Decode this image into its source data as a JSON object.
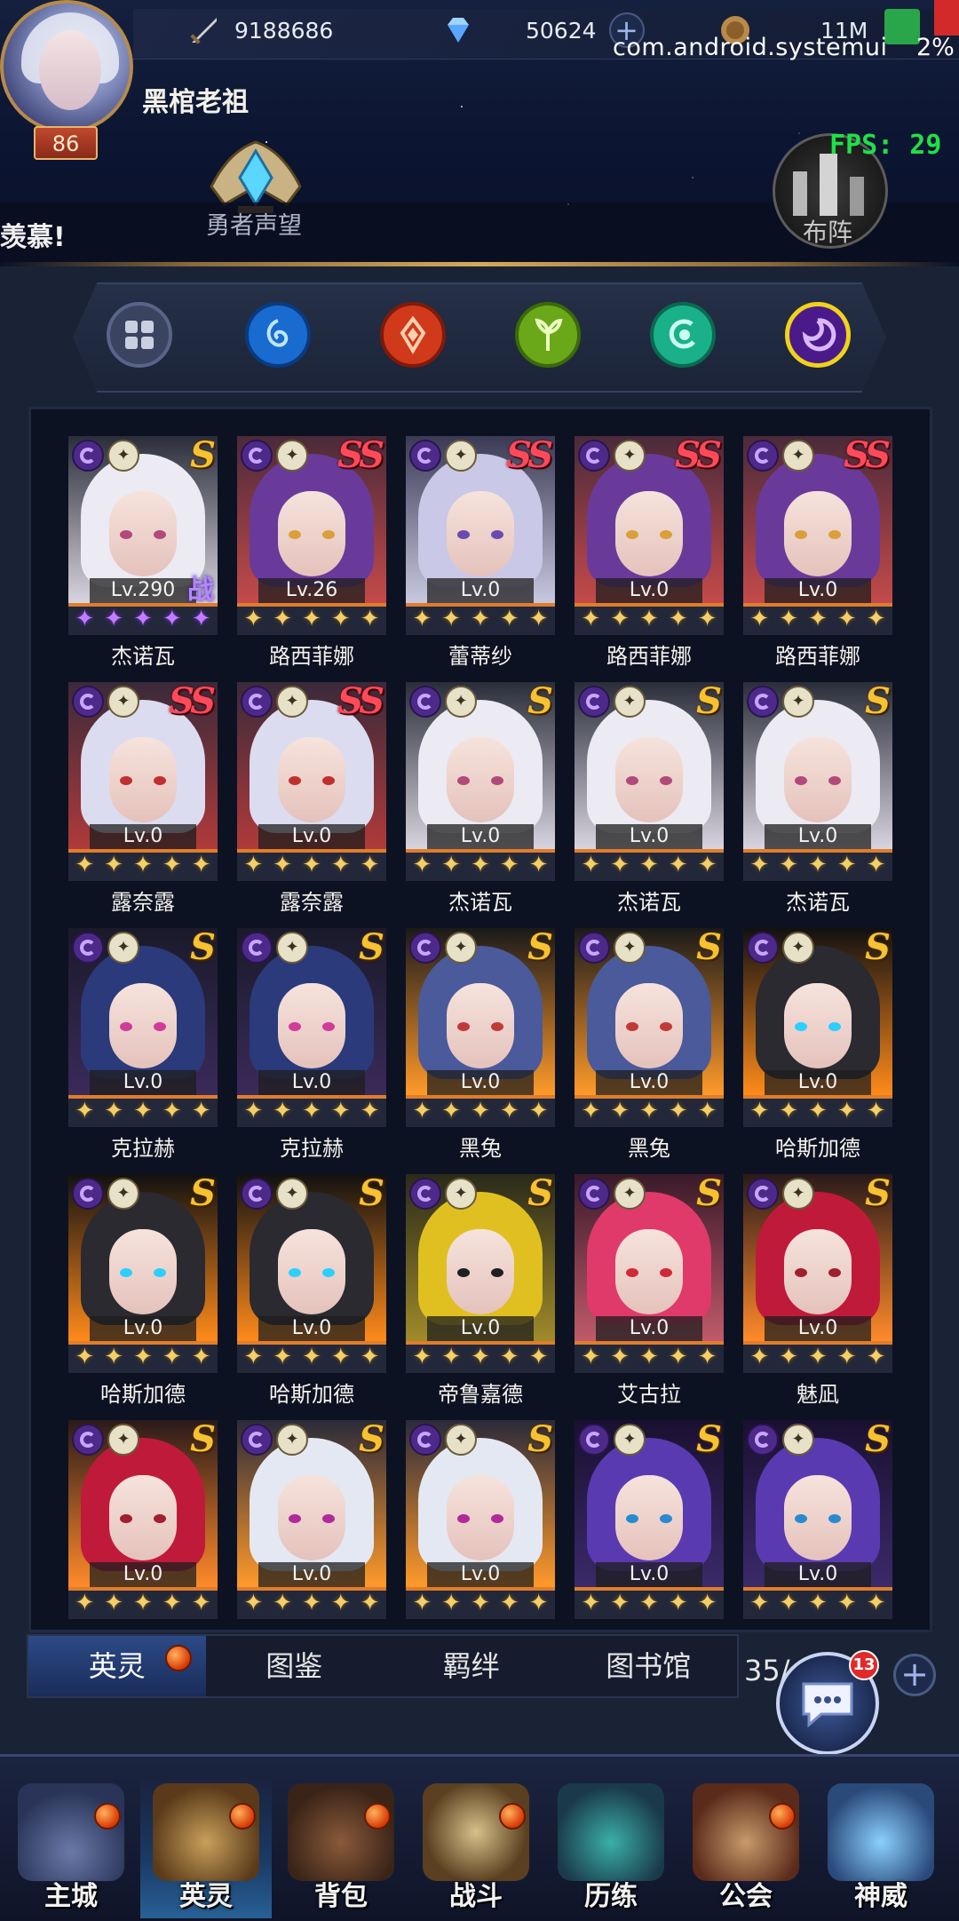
{
  "top": {
    "power_value": "9188686",
    "diamond_value": "50624",
    "coin_value": "11M",
    "system_overlay": "com.android.systemui",
    "system_percent": "2%",
    "fps": "FPS: 29",
    "player_level": "86",
    "player_name": "黑棺老祖",
    "marquee_text": "羡慕!",
    "badge_label": "勇者声望",
    "formation_label": "布阵"
  },
  "filters": [
    "all-icon",
    "water-icon",
    "fire-icon",
    "wind-icon",
    "light-icon",
    "dark-icon"
  ],
  "colors": {
    "accent": "#f3cf6a",
    "active_tab": "#2c4a86",
    "rank_s": "#f6c232",
    "rank_ss": "#ff4a5a"
  },
  "cards": [
    {
      "name": "杰诺瓦",
      "level": "Lv.290",
      "rank": "S",
      "stars": "purple",
      "badge": "战",
      "palette": "silver"
    },
    {
      "name": "路西菲娜",
      "level": "Lv.26",
      "rank": "SS",
      "stars": "gold",
      "palette": "violet"
    },
    {
      "name": "蕾蒂纱",
      "level": "Lv.0",
      "rank": "SS",
      "stars": "gold",
      "palette": "lavender"
    },
    {
      "name": "路西菲娜",
      "level": "Lv.0",
      "rank": "SS",
      "stars": "gold",
      "palette": "violet"
    },
    {
      "name": "路西菲娜",
      "level": "Lv.0",
      "rank": "SS",
      "stars": "gold",
      "palette": "violet"
    },
    {
      "name": "露奈露",
      "level": "Lv.0",
      "rank": "SS",
      "stars": "gold",
      "palette": "silverred"
    },
    {
      "name": "露奈露",
      "level": "Lv.0",
      "rank": "SS",
      "stars": "gold",
      "palette": "silverred"
    },
    {
      "name": "杰诺瓦",
      "level": "Lv.0",
      "rank": "S",
      "stars": "gold",
      "palette": "silver"
    },
    {
      "name": "杰诺瓦",
      "level": "Lv.0",
      "rank": "S",
      "stars": "gold",
      "palette": "silver"
    },
    {
      "name": "杰诺瓦",
      "level": "Lv.0",
      "rank": "S",
      "stars": "gold",
      "palette": "silver"
    },
    {
      "name": "克拉赫",
      "level": "Lv.0",
      "rank": "S",
      "stars": "gold",
      "palette": "navy"
    },
    {
      "name": "克拉赫",
      "level": "Lv.0",
      "rank": "S",
      "stars": "gold",
      "palette": "navy"
    },
    {
      "name": "黑兔",
      "level": "Lv.0",
      "rank": "S",
      "stars": "gold",
      "palette": "bluehat"
    },
    {
      "name": "黑兔",
      "level": "Lv.0",
      "rank": "S",
      "stars": "gold",
      "palette": "bluehat"
    },
    {
      "name": "哈斯加德",
      "level": "Lv.0",
      "rank": "S",
      "stars": "gold",
      "palette": "armor"
    },
    {
      "name": "哈斯加德",
      "level": "Lv.0",
      "rank": "S",
      "stars": "gold",
      "palette": "armor"
    },
    {
      "name": "哈斯加德",
      "level": "Lv.0",
      "rank": "S",
      "stars": "gold",
      "palette": "armor"
    },
    {
      "name": "帝鲁嘉德",
      "level": "Lv.0",
      "rank": "S",
      "stars": "gold",
      "palette": "golden"
    },
    {
      "name": "艾古拉",
      "level": "Lv.0",
      "rank": "S",
      "stars": "gold",
      "palette": "pink"
    },
    {
      "name": "魅凪",
      "level": "Lv.0",
      "rank": "S",
      "stars": "gold",
      "palette": "crimson"
    },
    {
      "name": "",
      "level": "Lv.0",
      "rank": "S",
      "stars": "gold",
      "palette": "crimson"
    },
    {
      "name": "",
      "level": "Lv.0",
      "rank": "S",
      "stars": "gold",
      "palette": "white"
    },
    {
      "name": "",
      "level": "Lv.0",
      "rank": "S",
      "stars": "gold",
      "palette": "white"
    },
    {
      "name": "",
      "level": "Lv.0",
      "rank": "S",
      "stars": "gold",
      "palette": "purplehair"
    },
    {
      "name": "",
      "level": "Lv.0",
      "rank": "S",
      "stars": "gold",
      "palette": "purplehair"
    }
  ],
  "tabs": [
    "英灵",
    "图鉴",
    "羁绊",
    "图书馆"
  ],
  "hero_count": "35/",
  "chat_badge": "13",
  "nav": [
    "主城",
    "英灵",
    "背包",
    "战斗",
    "历练",
    "公会",
    "神威"
  ]
}
